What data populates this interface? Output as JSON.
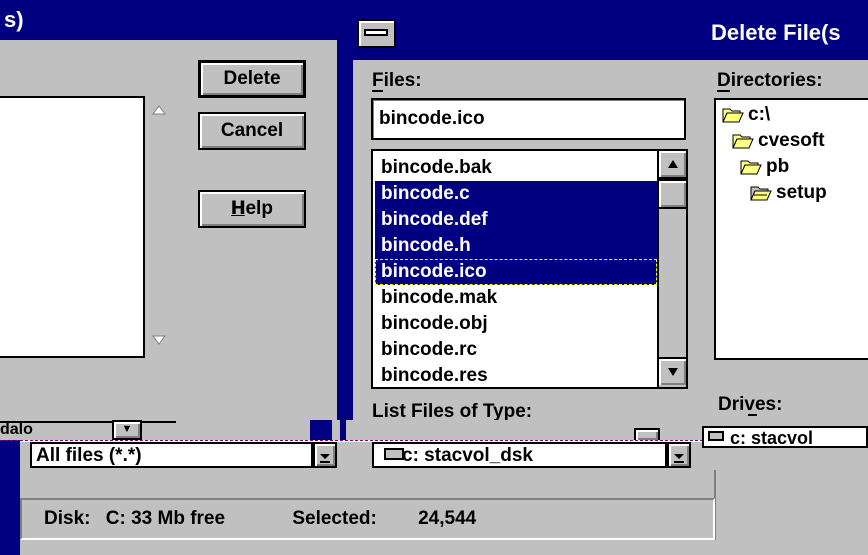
{
  "left_dialog": {
    "title_fragment": "s)",
    "buttons": {
      "delete": "Delete",
      "cancel": "Cancel",
      "help": "Help"
    },
    "type_combo_value": "All files (*.*)",
    "partial_label": "dalo"
  },
  "right_dialog": {
    "title": "Delete File(s",
    "files_label": "Files:",
    "files_input_value": "bincode.ico",
    "files": [
      {
        "name": "bincode.bak",
        "selected": false
      },
      {
        "name": "bincode.c",
        "selected": true
      },
      {
        "name": "bincode.def",
        "selected": true
      },
      {
        "name": "bincode.h",
        "selected": true
      },
      {
        "name": "bincode.ico",
        "selected": true,
        "focused": true
      },
      {
        "name": "bincode.mak",
        "selected": false
      },
      {
        "name": "bincode.obj",
        "selected": false
      },
      {
        "name": "bincode.rc",
        "selected": false
      },
      {
        "name": "bincode.res",
        "selected": false
      }
    ],
    "directories_label": "Directories:",
    "directories": [
      "c:\\",
      "cvesoft",
      "pb",
      "setup"
    ],
    "list_type_label": "List Files of Type:",
    "drives_label": "Drives:",
    "drive_combo_value": "c: stacvol_dsk",
    "drive_combo_value_2": "c: stacvol"
  },
  "status": {
    "disk_label": "Disk:",
    "disk_value": "C: 33 Mb free",
    "selected_label": "Selected:",
    "selected_value": "24,544"
  },
  "colors": {
    "title_bar": "#000080",
    "face": "#c0c0c0",
    "selection": "#000080"
  }
}
